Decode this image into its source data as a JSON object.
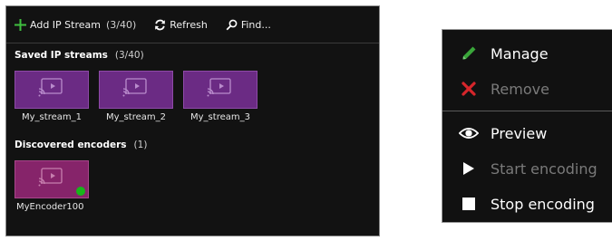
{
  "toolbar": {
    "add_label": "Add IP Stream",
    "add_count": "(3/40)",
    "refresh_label": "Refresh",
    "find_label": "Find..."
  },
  "saved_streams": {
    "title": "Saved IP streams",
    "count": "(3/40)",
    "items": [
      {
        "label": "My_stream_1"
      },
      {
        "label": "My_stream_2"
      },
      {
        "label": "My_stream_3"
      }
    ]
  },
  "discovered_encoders": {
    "title": "Discovered encoders",
    "count": "(1)",
    "items": [
      {
        "label": "MyEncoder100",
        "status": "online"
      }
    ]
  },
  "context_menu": {
    "items": [
      {
        "label": "Manage",
        "icon": "pencil-icon",
        "enabled": true
      },
      {
        "label": "Remove",
        "icon": "x-icon",
        "enabled": false
      },
      {
        "label": "Preview",
        "icon": "eye-icon",
        "enabled": true
      },
      {
        "label": "Start encoding",
        "icon": "play-icon",
        "enabled": false
      },
      {
        "label": "Stop encoding",
        "icon": "stop-icon",
        "enabled": true
      }
    ]
  },
  "colors": {
    "panel_bg": "#121212",
    "stream_tile": "#6b2b84",
    "encoder_tile": "#86246a",
    "status_online": "#17b51a",
    "add_icon": "#3fbf3f",
    "manage_icon": "#3aa63a",
    "remove_icon": "#d6262b"
  }
}
